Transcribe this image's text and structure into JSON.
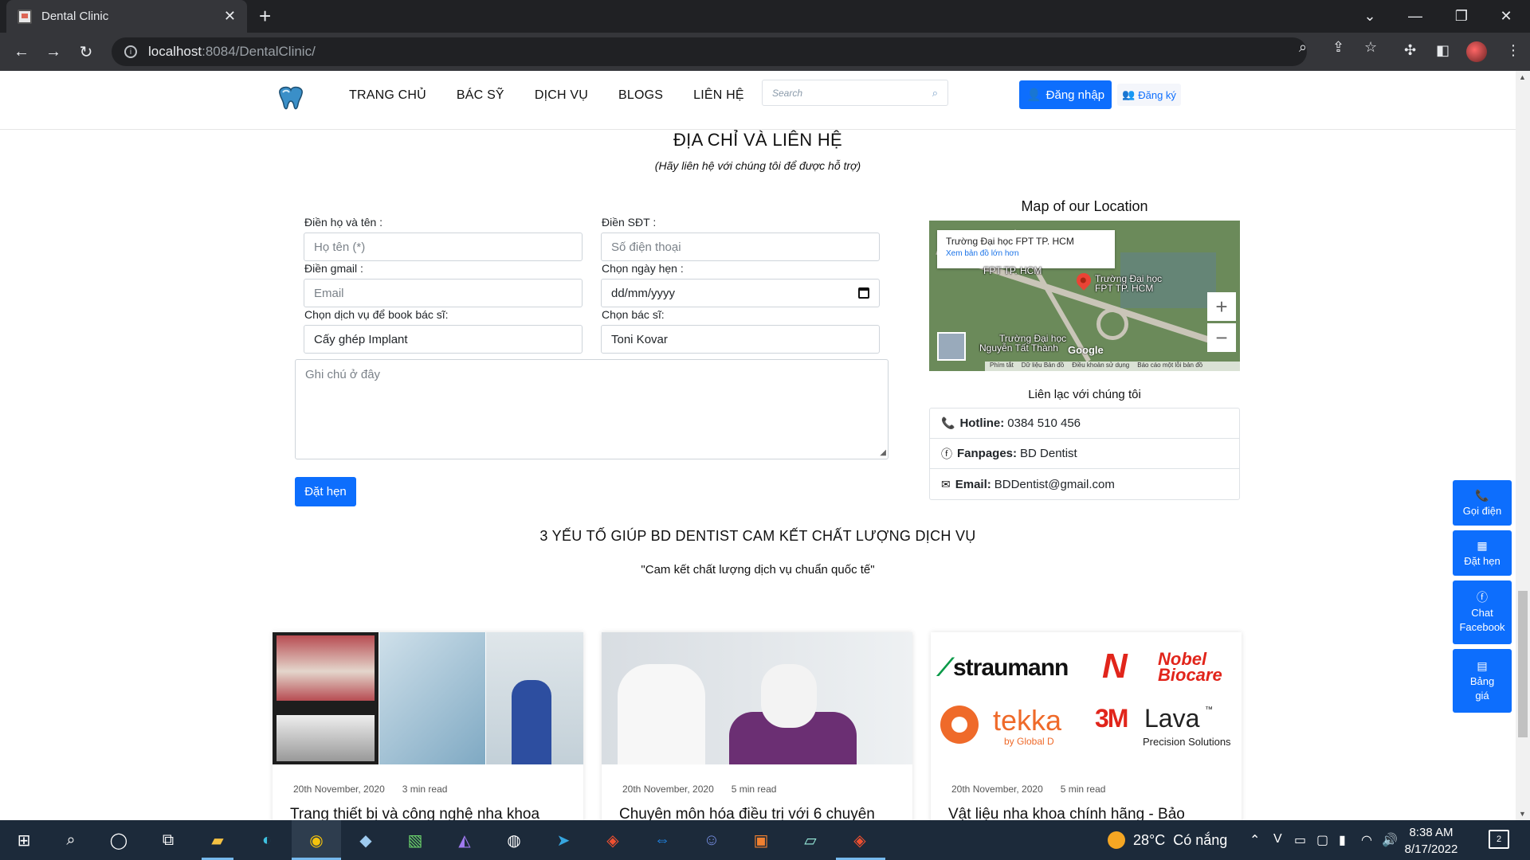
{
  "browser": {
    "tab_title": "Dental Clinic",
    "url_host": "localhost",
    "url_path": ":8084/DentalClinic/"
  },
  "nav": {
    "items": [
      "TRANG CHỦ",
      "BÁC SỸ",
      "DỊCH VỤ",
      "BLOGS",
      "LIÊN HỆ"
    ],
    "search_placeholder": "Search",
    "login_label": "Đăng nhập",
    "register_label": "Đăng ký"
  },
  "contact_section": {
    "title": "ĐỊA CHỈ VÀ LIÊN HỆ",
    "subtitle": "(Hãy liên hệ với chúng tôi để được hỗ trợ)"
  },
  "form": {
    "name_label": "Điền họ và tên :",
    "name_placeholder": "Họ tên (*)",
    "phone_label": "Điền SĐT :",
    "phone_placeholder": "Số điện thoại",
    "email_label": "Điền gmail :",
    "email_placeholder": "Email",
    "date_label": "Chọn ngày hẹn :",
    "date_value": "dd/mm/yyyy",
    "service_label": "Chọn dịch vụ để book bác sĩ:",
    "service_value": "Cấy ghép Implant",
    "doctor_label": "Chọn bác sĩ:",
    "doctor_value": "Toni Kovar",
    "note_placeholder": "Ghi chú ở đây",
    "submit_label": "Đặt hẹn"
  },
  "map": {
    "title": "Map of our Location",
    "place_name": "Trường Đại học FPT TP. HCM",
    "larger_map_link": "Xem bản đồ lớn hơn",
    "label_fpt_top": "FPT TP. HCM",
    "label_fpt_line1": "Trường Đại học",
    "label_fpt_line2": "FPT TP. HCM",
    "label_ntt_line1": "Trường Đại học",
    "label_ntt_line2": "Nguyễn Tất Thành",
    "google_logo": "Google",
    "footer": [
      "Phím tắt",
      "Dữ liệu Bản đồ",
      "Điều khoản sử dụng",
      "Báo cáo một lỗi bản đồ"
    ]
  },
  "contact_info": {
    "title": "Liên lạc với chúng tôi",
    "hotline_label": "Hotline:",
    "hotline_value": "0384 510 456",
    "fanpage_label": "Fanpages:",
    "fanpage_value": "BD Dentist",
    "email_label": "Email:",
    "email_value": "BDDentist@gmail.com"
  },
  "quality_section": {
    "title": "3 YẾU TỐ GIÚP BD DENTIST CAM KẾT CHẤT LƯỢNG DỊCH VỤ",
    "subtitle": "\"Cam kết chất lượng dịch vụ chuẩn quốc tế\""
  },
  "cards": [
    {
      "date": "20th November, 2020",
      "read": "3 min read",
      "title": "Trang thiết bị và công nghệ nha khoa"
    },
    {
      "date": "20th November, 2020",
      "read": "5 min read",
      "title": "Chuyên môn hóa điều trị với 6 chuyên"
    },
    {
      "date": "20th November, 2020",
      "read": "5 min read",
      "title": "Vật liệu nha khoa chính hãng - Bảo"
    }
  ],
  "brands": {
    "straumann": "straumann",
    "nobel_1": "Nobel",
    "nobel_2": "Biocare",
    "tekka": "tekka",
    "tekka_sub": "by Global D",
    "lava_3m": "3M",
    "lava": "Lava",
    "lava_tm": "™",
    "lava_sub": "Precision Solutions"
  },
  "float_buttons": [
    {
      "label": "Gọi điện",
      "icon": "phone-icon"
    },
    {
      "label": "Đặt hẹn",
      "icon": "calendar-icon"
    },
    {
      "label": "Chat Facebook",
      "icon": "facebook-icon"
    },
    {
      "label": "Bảng giá",
      "icon": "table-icon"
    }
  ],
  "taskbar": {
    "weather_temp": "28°C",
    "weather_desc": "Có nắng",
    "time": "8:38 AM",
    "date": "8/17/2022",
    "notifications": "2"
  }
}
